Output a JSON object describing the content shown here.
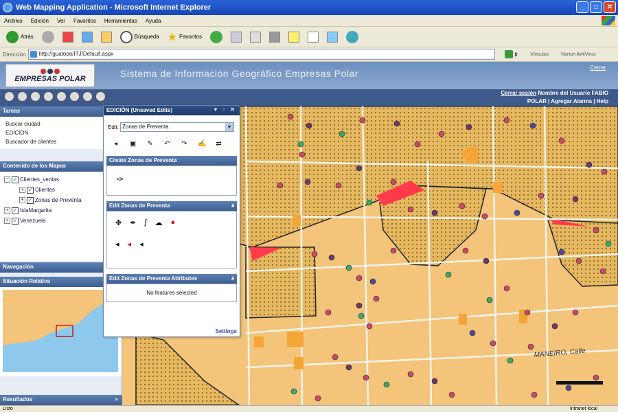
{
  "window": {
    "title": "Web Mapping Application - Microsoft Internet Explorer"
  },
  "menu": [
    "Archivo",
    "Edición",
    "Ver",
    "Favoritos",
    "Herramientas",
    "Ayuda"
  ],
  "toolbar": {
    "back": "Atrás",
    "search": "Búsqueda",
    "favorites": "Favoritos"
  },
  "address": {
    "label": "Dirección",
    "url": "http://guatopo/ITJ/Default.aspx",
    "go": "Ir",
    "links": "Vínculos",
    "antivirus": "Norton AntiVirus"
  },
  "app": {
    "title": "Sistema de Información Geográfico Empresas Polar",
    "logo": "EMPRESAS POLAR",
    "logout": "Cerrar"
  },
  "user": {
    "session": "Cerrar sesión",
    "name_label": "Nombre del Usuario FABIO",
    "company": "POLAR",
    "add_alarm": "Agregar Alarma",
    "help": "Help"
  },
  "left": {
    "tasks_title": "Tareas",
    "tasks": [
      "Buscar ciudad",
      "EDICION",
      "Buscador de clientes"
    ],
    "contents_title": "Contenido de los Mapas",
    "layers": [
      {
        "label": "Clientes_ventas",
        "level": 0
      },
      {
        "label": "Clientes",
        "level": 1
      },
      {
        "label": "Zonas de Preventa",
        "level": 1
      },
      {
        "label": "IslaMargarita",
        "level": 0
      },
      {
        "label": "Venezuela",
        "level": 0
      }
    ],
    "nav_title": "Navegación",
    "overview_title": "Situación Relativa",
    "results_title": "Resultados"
  },
  "edit": {
    "title": "EDICIÓN (Unsaved Edits)",
    "edit_label": "Edit:",
    "layer_selected": "Zonas de Preventa",
    "create_title": "Create Zonas de Preventa",
    "edit_title": "Edit Zonas de Preventa",
    "attributes_title": "Edit Zonas de Preventa Attributes",
    "no_features": "No features selected",
    "settings": "Settings"
  },
  "map": {
    "street_label": "MANEIRO, Calle"
  },
  "status": {
    "left": "Listo",
    "zone": "Intranet local"
  },
  "colors": {
    "map_bg": "#f3c47a",
    "zone_fill": "#e0b060",
    "highlight": "#ff3b4a",
    "header": "#3d5a8a"
  }
}
